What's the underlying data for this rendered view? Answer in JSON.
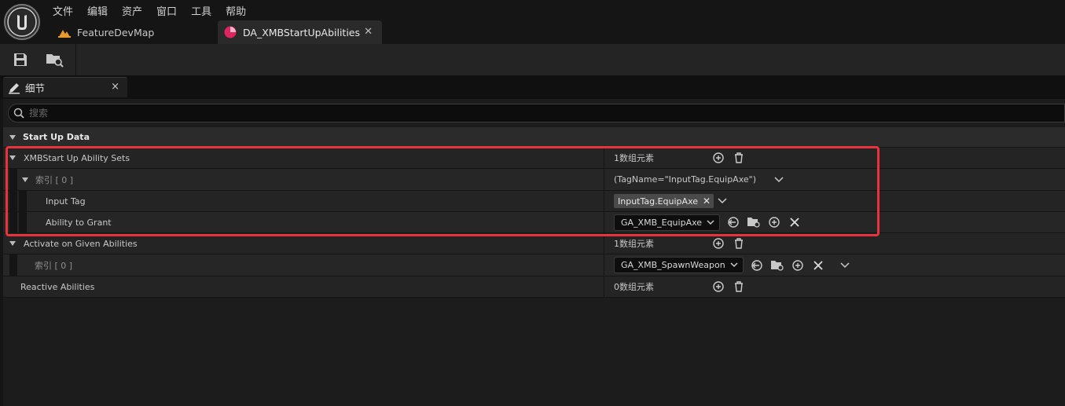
{
  "menu": [
    "文件",
    "编辑",
    "资产",
    "窗口",
    "工具",
    "帮助"
  ],
  "tabs": [
    {
      "label": "FeatureDevMap"
    },
    {
      "label": "DA_XMBStartUpAbilities"
    }
  ],
  "panel": {
    "title": "细节",
    "close": "×"
  },
  "search": {
    "placeholder": "搜索"
  },
  "category": {
    "label": "Start Up Data"
  },
  "rows": {
    "ability_sets": {
      "label": "XMBStart Up Ability Sets",
      "value": "1数组元素"
    },
    "index0": {
      "label": "索引 [ 0 ]",
      "value": "(TagName=\"InputTag.EquipAxe\")"
    },
    "input_tag": {
      "label": "Input Tag",
      "value": "InputTag.EquipAxe"
    },
    "ability_grant": {
      "label": "Ability to Grant",
      "value": "GA_XMB_EquipAxe"
    },
    "given": {
      "label": "Activate on Given Abilities",
      "value": "1数组元素"
    },
    "given_index0": {
      "label": "索引 [ 0 ]",
      "value": "GA_XMB_SpawnWeapon"
    },
    "reactive": {
      "label": "Reactive Abilities",
      "value": "0数组元素"
    }
  },
  "colors": {
    "highlight": "#e8333d",
    "asset_tab_icon": "#e0245e",
    "level_icon": "#e89a2c"
  }
}
